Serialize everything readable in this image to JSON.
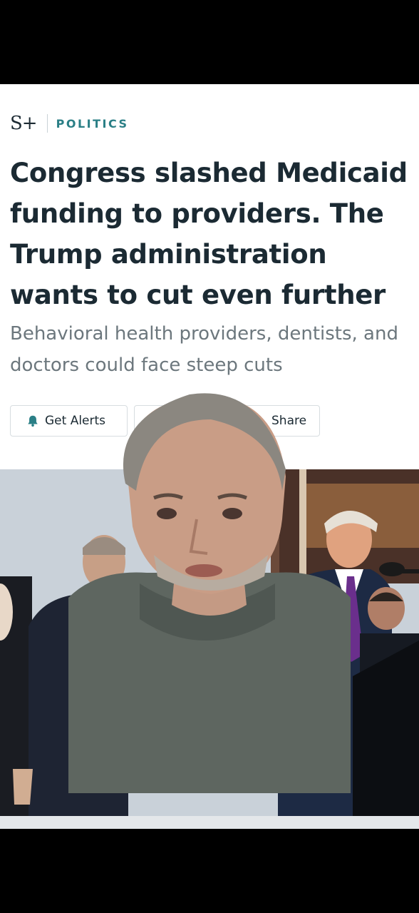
{
  "brand": {
    "logo": "S+",
    "section": "POLITICS"
  },
  "article": {
    "headline": "Congress slashed Medicaid funding to providers. The Trump administration wants to cut even further",
    "dek": "Behavioral health providers, dentists, and doctors could face steep cuts"
  },
  "actions": {
    "alerts_label": "Get Alerts",
    "share_label": "Share"
  },
  "colors": {
    "accent": "#2a7f86",
    "headline": "#1b2a33",
    "dek": "#6c777d"
  }
}
